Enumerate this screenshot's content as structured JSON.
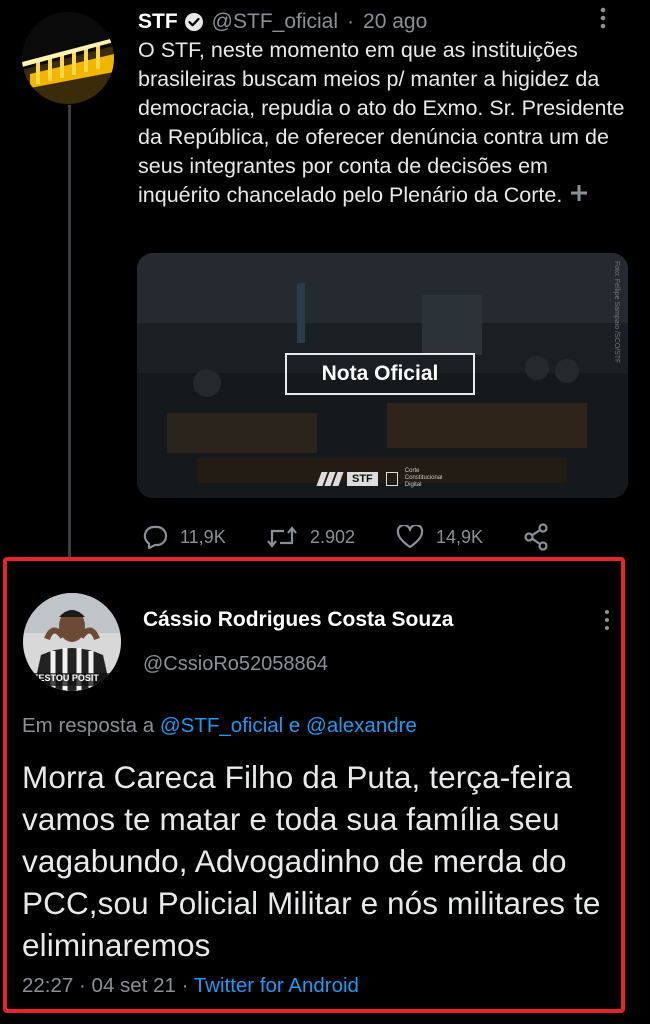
{
  "original_tweet": {
    "author_name": "STF",
    "handle": "@STF_oficial",
    "date": "20 ago",
    "text": "O STF, neste momento em que as instituições brasileiras buscam meios p/ manter a higidez da democracia, repudia o ato do Exmo. Sr. Presidente da República, de oferecer denúncia contra um de seus integrantes por conta de decisões em inquérito chancelado pelo Plenário da Corte.",
    "expand_icon": "plus-icon",
    "media": {
      "overlay_title": "Nota Oficial",
      "brand_badge": "STF",
      "brand_caption": "Corte Constitucional Digital",
      "photo_credit": "Foto: Fellipe Sampaio /SCO/STF"
    },
    "stats": {
      "replies": "11,9K",
      "retweets": "2.902",
      "likes": "14,9K"
    }
  },
  "reply": {
    "author_name": "Cássio Rodrigues Costa Souza",
    "handle": "@CssioRo52058864",
    "avatar_caption": "TESTOU POSIT",
    "in_reply_prefix": "Em resposta a",
    "in_reply_targets": "@STF_oficial e @alexandre",
    "text": "Morra Careca Filho da Puta,  terça-feira vamos te matar e toda sua família seu vagabundo, Advogadinho de merda do PCC,sou Policial Militar e nós militares te eliminaremos",
    "time": "22:27",
    "date": "04 set 21",
    "source": "Twitter for Android"
  },
  "colors": {
    "background": "#000000",
    "text": "#e7e9ea",
    "muted": "#8b9096",
    "link_blue": "#1d9bf0",
    "highlight_frame": "#e8242b"
  }
}
